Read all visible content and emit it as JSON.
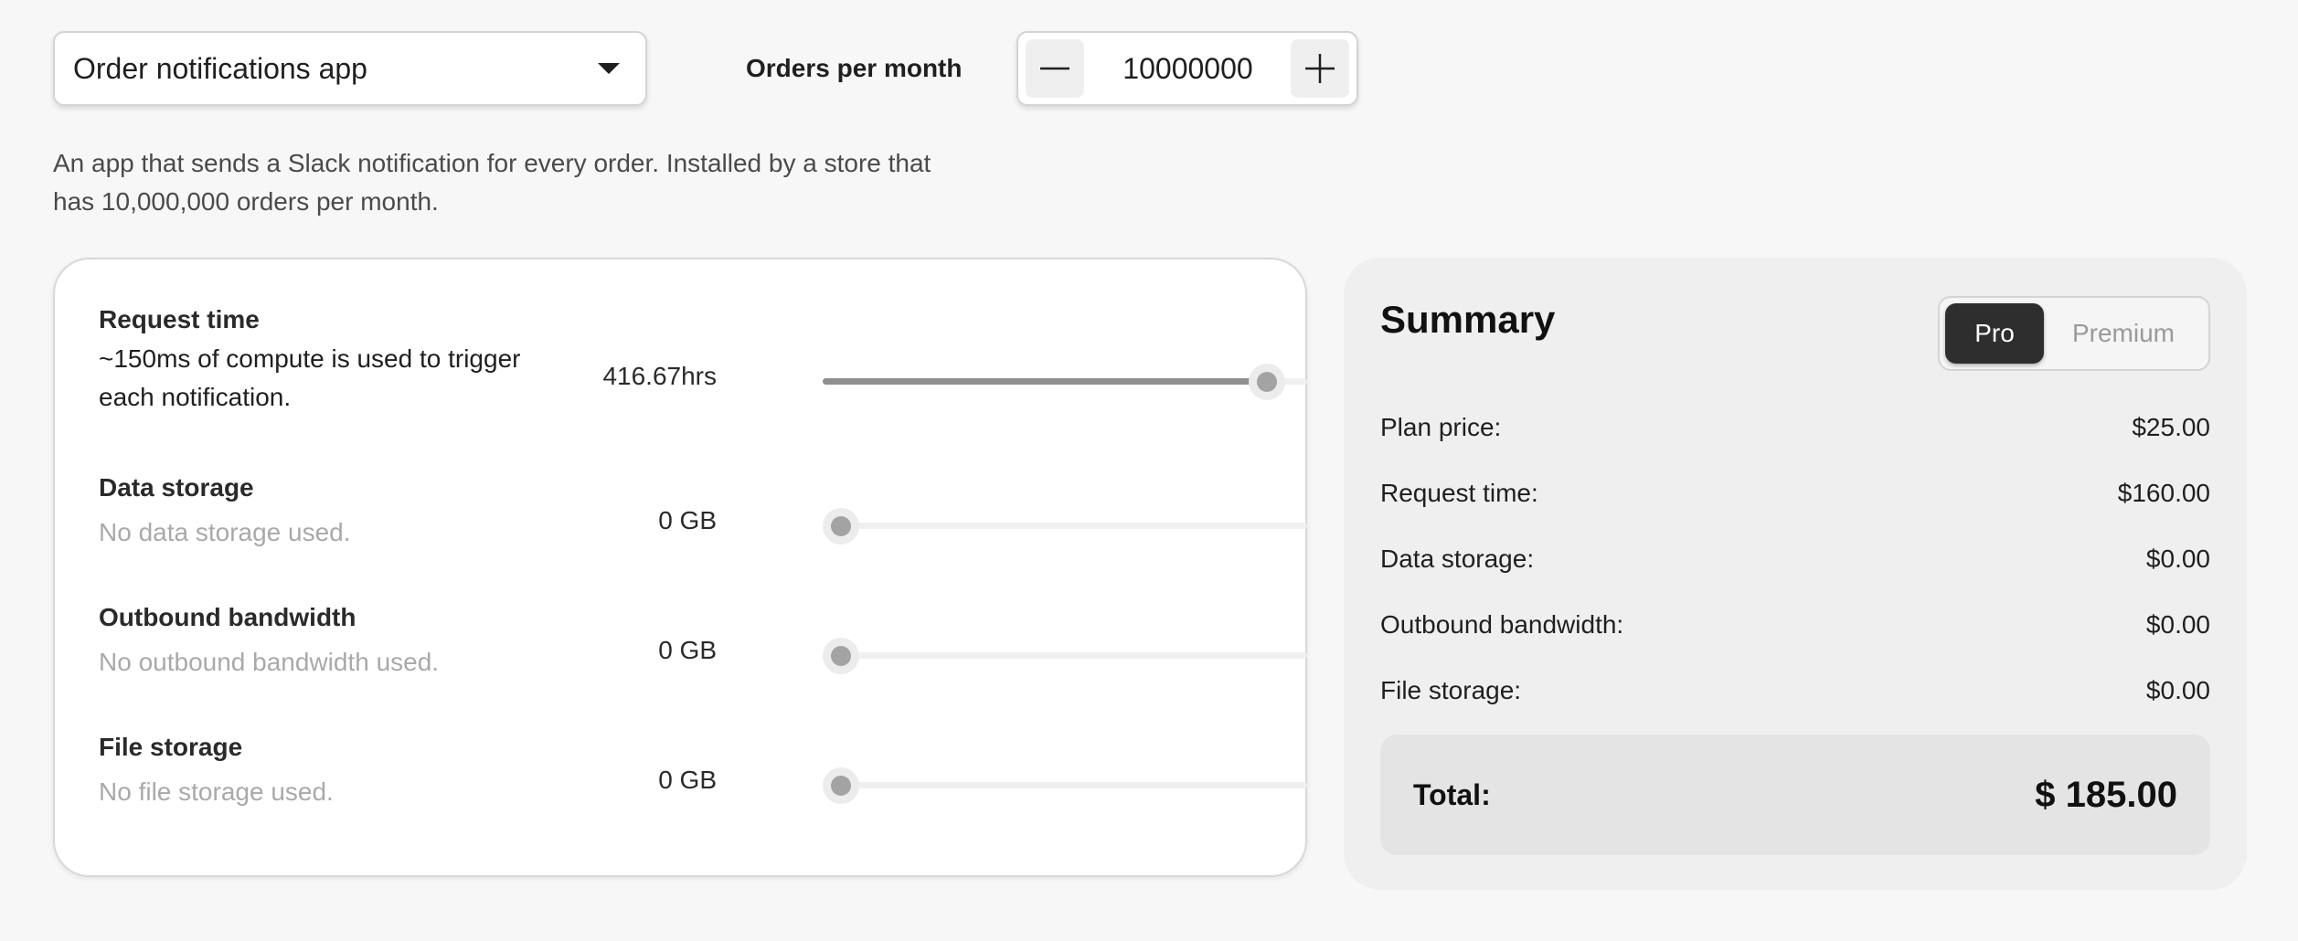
{
  "controls": {
    "app_select": {
      "value": "Order notifications app"
    },
    "orders_label": "Orders per month",
    "orders_value": "10000000"
  },
  "description": "An app that sends a Slack notification for every order. Installed by a store that has 10,000,000 orders per month.",
  "usage": [
    {
      "title": "Request time",
      "description": "~150ms of compute is used to trigger each notification.",
      "amount": "416.67hrs",
      "slider_fraction": 0.95
    },
    {
      "title": "Data storage",
      "description": "No data storage used.",
      "amount": "0 GB",
      "slider_fraction": 0
    },
    {
      "title": "Outbound bandwidth",
      "description": "No outbound bandwidth used.",
      "amount": "0 GB",
      "slider_fraction": 0
    },
    {
      "title": "File storage",
      "description": "No file storage used.",
      "amount": "0 GB",
      "slider_fraction": 0
    }
  ],
  "summary": {
    "title": "Summary",
    "plans": {
      "active": "Pro",
      "other": "Premium"
    },
    "lines": [
      {
        "label": "Plan price:",
        "value": "$25.00"
      },
      {
        "label": "Request time:",
        "value": "$160.00"
      },
      {
        "label": "Data storage:",
        "value": "$0.00"
      },
      {
        "label": "Outbound bandwidth:",
        "value": "$0.00"
      },
      {
        "label": "File storage:",
        "value": "$0.00"
      }
    ],
    "total_label": "Total:",
    "total_value": "$ 185.00"
  },
  "icons": {
    "dropdown": "chevron-down-icon",
    "decrement": "minus-icon",
    "increment": "plus-icon"
  }
}
